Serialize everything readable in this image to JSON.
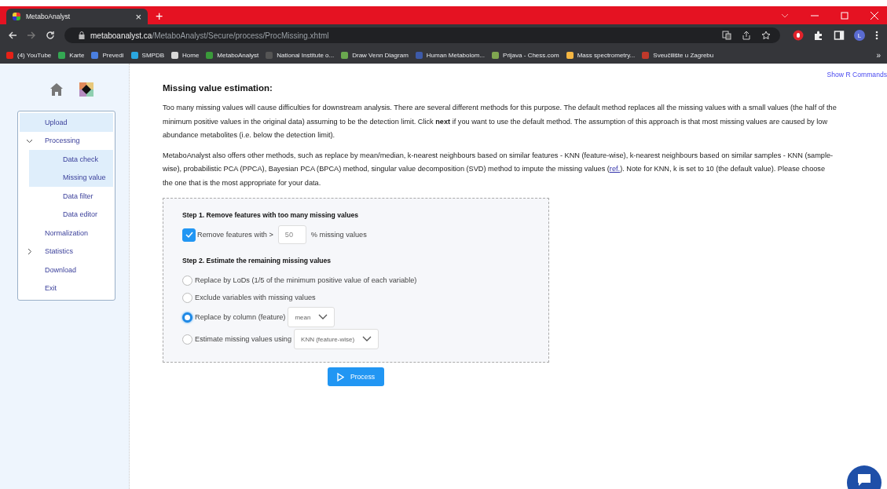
{
  "browser": {
    "tab": {
      "title": "MetaboAnalyst",
      "close": "×"
    },
    "new_tab": "+",
    "url": {
      "host": "metaboanalyst.ca",
      "path": "/MetaboAnalyst/Secure/process/ProcMissing.xhtml"
    },
    "profile": "L",
    "bookmarks": [
      {
        "label": "(4) YouTube",
        "color": "#e62117"
      },
      {
        "label": "Karte",
        "color": "#34a853"
      },
      {
        "label": "Prevedi",
        "color": "#4a7fe0"
      },
      {
        "label": "SMPDB",
        "color": "#2aa7e0"
      },
      {
        "label": "Home",
        "color": "#d8d8d8"
      },
      {
        "label": "MetaboAnalyst",
        "color": "#3a9a3a"
      },
      {
        "label": "National Institute o...",
        "color": "#555555"
      },
      {
        "label": "Draw Venn Diagram",
        "color": "#6aa84f"
      },
      {
        "label": "Human Metabolom...",
        "color": "#3d5aa8"
      },
      {
        "label": "Prijava - Chess.com",
        "color": "#7fa650"
      },
      {
        "label": "Mass spectrometry...",
        "color": "#f5b642"
      },
      {
        "label": "Sveučilište u Zagrebu",
        "color": "#c0392b"
      }
    ],
    "bookmarks_more": "»"
  },
  "sidebar": {
    "items": [
      {
        "label": "Upload",
        "selected": true
      },
      {
        "label": "Processing",
        "selected": false,
        "expanded": true,
        "children": [
          {
            "label": "Data check",
            "selected": true
          },
          {
            "label": "Missing value",
            "selected": true
          },
          {
            "label": "Data filter",
            "selected": false
          },
          {
            "label": "Data editor",
            "selected": false
          }
        ]
      },
      {
        "label": "Normalization",
        "selected": false
      },
      {
        "label": "Statistics",
        "selected": false,
        "expanded": false
      },
      {
        "label": "Download",
        "selected": false
      },
      {
        "label": "Exit",
        "selected": false
      }
    ]
  },
  "show_r_commands": "Show R Commands",
  "heading": "Missing value estimation:",
  "paragraph_1": "Too many missing values will cause difficulties for downstream analysis. There are several different methods for this purpose. The default method replaces all the missing values with a small values (the half of the minimum positive values in the original data) assuming to be the detection limit. Click **next** if you want to use the default method. The assumption of this approach is that most missing values are caused by low abundance metabolites (i.e. below the detection limit).",
  "paragraph_2": {
    "before": "MetaboAnalyst also offers other methods, such as replace by mean/median, k-nearest neighbours based on similar features - KNN (feature-wise), k-nearest neighbours based on similar samples - KNN (sample-wise), probabilistic PCA (PPCA), Bayesian PCA (BPCA) method, singular value decomposition (SVD) method to impute the missing values (",
    "link": "ref.",
    "after": "). Note for KNN, k is set to 10 (the default value). Please choose the one that is the most appropriate for your data."
  },
  "step1": {
    "title": "Step 1. Remove features with too many missing values",
    "checked": true,
    "label_before": "Remove features with >",
    "value": "50",
    "label_after": "% missing values"
  },
  "step2": {
    "title": "Step 2. Estimate the remaining missing values",
    "options": [
      {
        "label": "Replace by LoDs (1/5 of the minimum positive value of each variable)",
        "selected": false
      },
      {
        "label": "Exclude variables with missing values",
        "selected": false
      },
      {
        "label": "Replace by column (feature)",
        "selected": true,
        "select": "mean"
      },
      {
        "label": "Estimate missing values using",
        "selected": false,
        "select": "KNN (feature-wise)"
      }
    ]
  },
  "process_button": "Process"
}
